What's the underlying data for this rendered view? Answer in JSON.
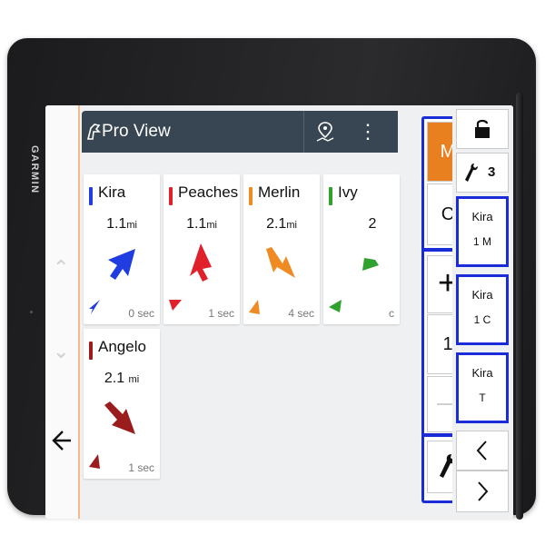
{
  "device": {
    "brand": "GARMIN"
  },
  "header": {
    "title": "Pro View"
  },
  "cards": [
    {
      "name": "Kira",
      "distance": "1.1",
      "unit": "mi",
      "age": "0 sec",
      "color": "#1f3de0"
    },
    {
      "name": "Peaches",
      "distance": "1.1",
      "unit": "mi",
      "age": "1 sec",
      "color": "#e0202a"
    },
    {
      "name": "Merlin",
      "distance": "2.1",
      "unit": "mi",
      "age": "4 sec",
      "color": "#f08a22"
    },
    {
      "name": "Ivy",
      "distance": "2",
      "unit": "",
      "age": "c",
      "color": "#2ea12e"
    },
    {
      "name": "Angelo",
      "distance": "2.1",
      "unit": "mi",
      "age": "1 sec",
      "color": "#9b1c1c"
    }
  ],
  "controls": {
    "m_label": "M",
    "c_label": "C",
    "plus_label": "+",
    "value": "1"
  },
  "sidebar": {
    "lock_icon": "lock-icon",
    "tools_label": "3",
    "dogs": [
      {
        "name": "Kira",
        "line2": "1  M"
      },
      {
        "name": "Kira",
        "line2": "1  C"
      },
      {
        "name": "Kira",
        "line2": "T"
      }
    ]
  },
  "colors": {
    "accent": "#e9801f",
    "highlight": "#1a2bd8",
    "header": "#384552"
  }
}
